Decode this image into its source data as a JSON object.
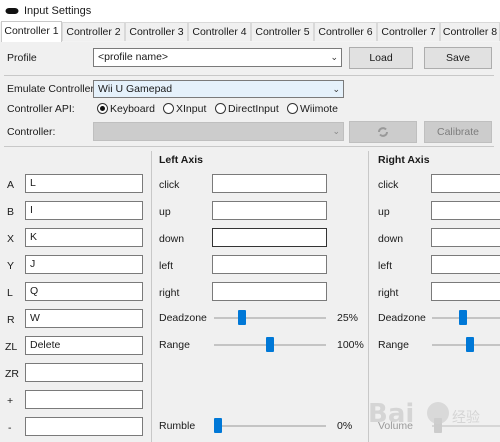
{
  "window": {
    "title": "Input Settings"
  },
  "tabs": [
    "Controller 1",
    "Controller 2",
    "Controller 3",
    "Controller 4",
    "Controller 5",
    "Controller 6",
    "Controller 7",
    "Controller 8"
  ],
  "profile": {
    "label": "Profile",
    "value": "<profile name>",
    "load_label": "Load",
    "save_label": "Save"
  },
  "emulate": {
    "label": "Emulate Controller",
    "value": "Wii U Gamepad"
  },
  "api": {
    "label": "Controller API:",
    "options": [
      "Keyboard",
      "XInput",
      "DirectInput",
      "Wiimote"
    ],
    "selected": "Keyboard"
  },
  "controller": {
    "label": "Controller:",
    "value": "",
    "calibrate_label": "Calibrate"
  },
  "buttons": [
    {
      "label": "A",
      "value": "L"
    },
    {
      "label": "B",
      "value": "I"
    },
    {
      "label": "X",
      "value": "K"
    },
    {
      "label": "Y",
      "value": "J"
    },
    {
      "label": "L",
      "value": "Q"
    },
    {
      "label": "R",
      "value": "W"
    },
    {
      "label": "ZL",
      "value": "Delete"
    },
    {
      "label": "ZR",
      "value": ""
    },
    {
      "label": "+",
      "value": ""
    },
    {
      "label": "-",
      "value": ""
    }
  ],
  "left_axis": {
    "title": "Left Axis",
    "rows": [
      {
        "label": "click",
        "value": ""
      },
      {
        "label": "up",
        "value": ""
      },
      {
        "label": "down",
        "value": ""
      },
      {
        "label": "left",
        "value": ""
      },
      {
        "label": "right",
        "value": ""
      }
    ],
    "deadzone": {
      "label": "Deadzone",
      "value_text": "25%",
      "value": 0.25
    },
    "range": {
      "label": "Range",
      "value_text": "100%",
      "value": 0.5
    },
    "rumble": {
      "label": "Rumble",
      "value_text": "0%",
      "value": 0.0
    }
  },
  "right_axis": {
    "title": "Right Axis",
    "rows": [
      {
        "label": "click",
        "value": ""
      },
      {
        "label": "up",
        "value": ""
      },
      {
        "label": "down",
        "value": ""
      },
      {
        "label": "left",
        "value": ""
      },
      {
        "label": "right",
        "value": ""
      }
    ],
    "deadzone": {
      "label": "Deadzone"
    },
    "range": {
      "label": "Range"
    },
    "volume": {
      "label": "Volume"
    }
  },
  "colors": {
    "accent": "#0078d7",
    "panel": "#f0f0f0",
    "disabled": "#cccccc"
  }
}
